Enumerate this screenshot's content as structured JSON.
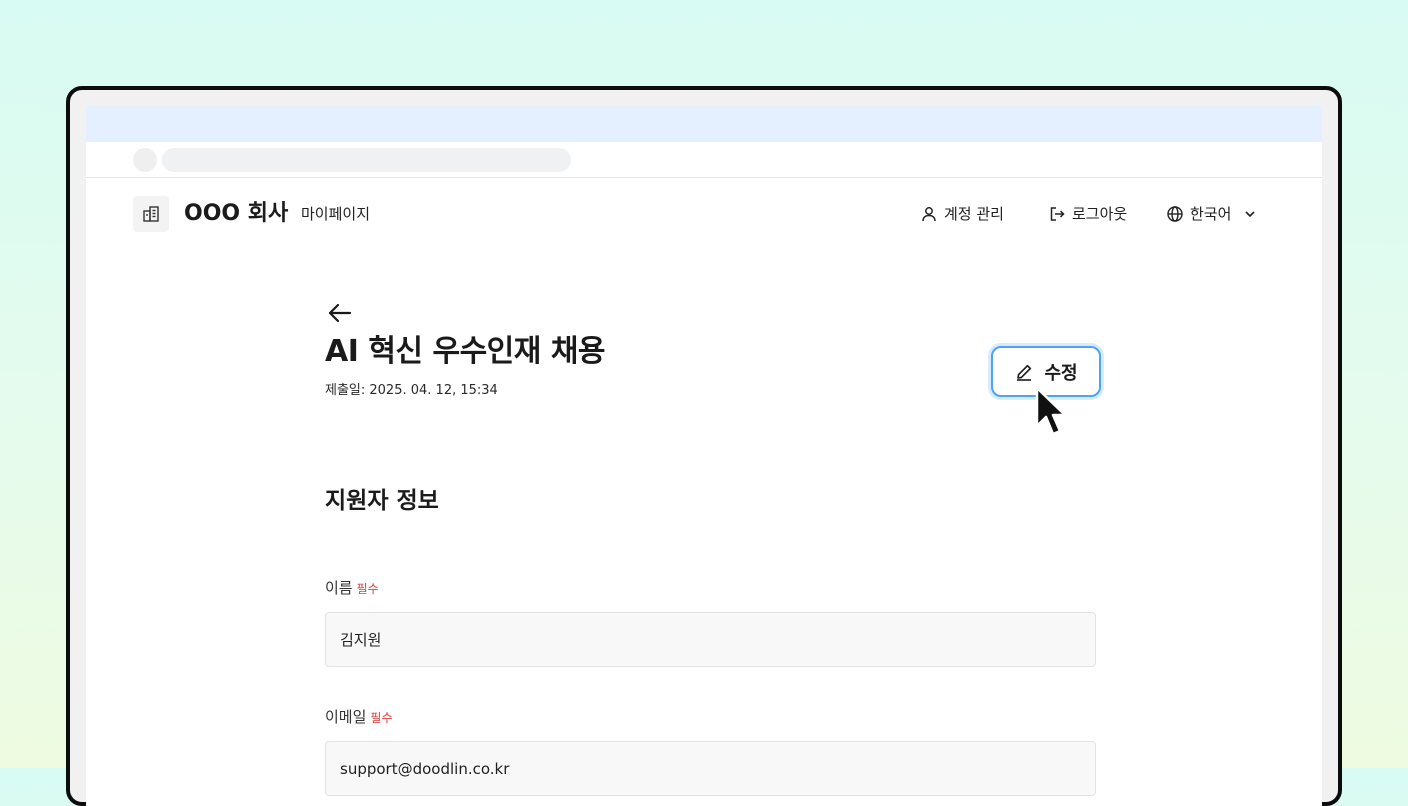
{
  "header": {
    "company": "OOO 회사",
    "mypage": "마이페이지",
    "account_label": "계정 관리",
    "logout_label": "로그아웃",
    "language_label": "한국어"
  },
  "page": {
    "title": "AI 혁신 우수인재 채용",
    "submitted": "제출일: 2025. 04. 12, 15:34",
    "edit_label": "수정"
  },
  "section": {
    "title": "지원자 정보",
    "fields": [
      {
        "label": "이름",
        "required": "필수",
        "value": "김지원"
      },
      {
        "label": "이메일",
        "required": "필수",
        "value": "support@doodlin.co.kr"
      }
    ]
  },
  "colors": {
    "accent": "#4ea3f5",
    "required": "#e03a3a",
    "browser_top": "#e4efff"
  },
  "icons": {
    "logo": "building-icon",
    "account": "user-icon",
    "logout": "logout-icon",
    "language": "globe-icon",
    "dropdown": "chevron-down-icon",
    "back": "arrow-left-icon",
    "edit": "pencil-icon",
    "pointer": "mouse-cursor-icon"
  }
}
